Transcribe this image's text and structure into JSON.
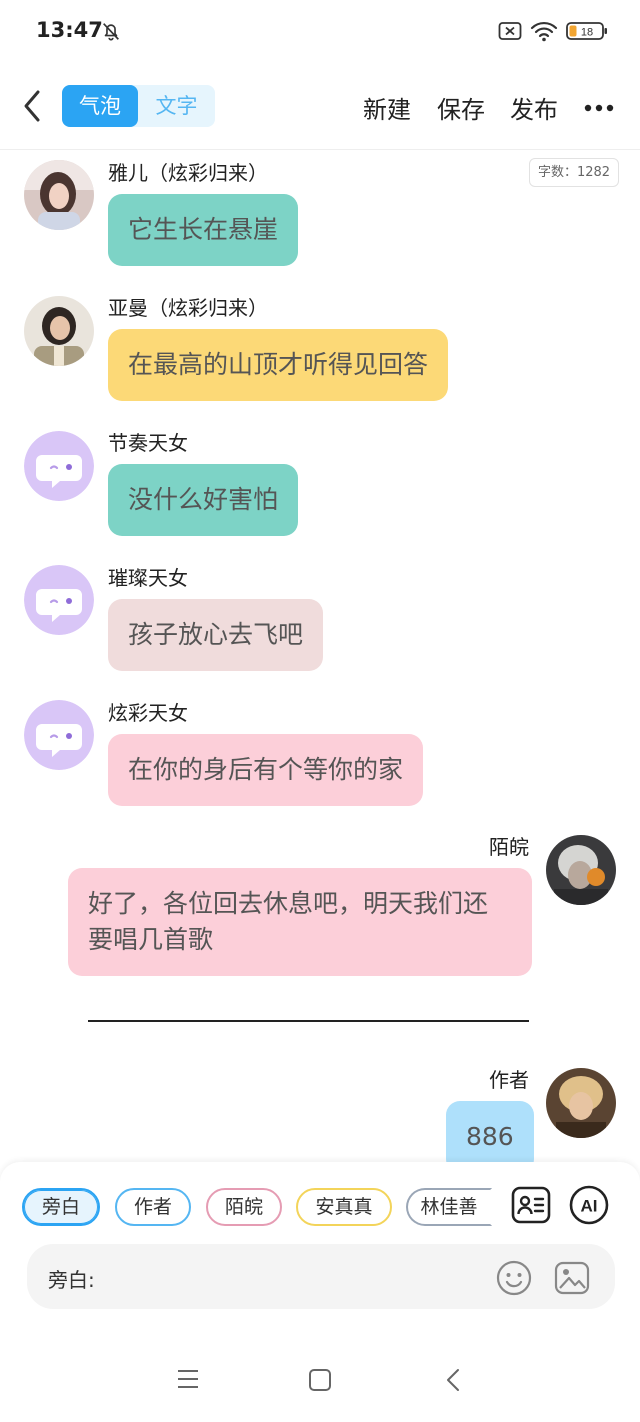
{
  "status_bar": {
    "time": "13:47",
    "battery": "18"
  },
  "header": {
    "mode_bubble": "气泡",
    "mode_text": "文字",
    "new_label": "新建",
    "save_label": "保存",
    "publish_label": "发布"
  },
  "word_count": "字数：1282",
  "messages": [
    {
      "name": "雅儿（炫彩归来）",
      "text": "它生长在悬崖",
      "color": "#7dd3c6"
    },
    {
      "name": "亚曼（炫彩归来）",
      "text": "在最高的山顶才听得见回答",
      "color": "#fcd977"
    },
    {
      "name": "节奏天女",
      "text": "没什么好害怕",
      "color": "#7dd3c6"
    },
    {
      "name": "璀璨天女",
      "text": "孩子放心去飞吧",
      "color": "#f0dcdc"
    },
    {
      "name": "炫彩天女",
      "text": "在你的身后有个等你的家",
      "color": "#fccfd9"
    },
    {
      "name": "陌皖",
      "text": "好了，各位回去休息吧，明天我们还要唱几首歌",
      "color": "#fccfd9"
    },
    {
      "name": "作者",
      "text": "886",
      "color": "#aee0fb"
    }
  ],
  "roles": [
    {
      "label": "旁白",
      "color": "#2ba4f3"
    },
    {
      "label": "作者",
      "color": "#55b6f2"
    },
    {
      "label": "陌皖",
      "color": "#e59cb3"
    },
    {
      "label": "安真真",
      "color": "#f3d45a"
    },
    {
      "label": "林佳善",
      "color": "#9aa6b6"
    }
  ],
  "input": {
    "label": "旁白:"
  },
  "colors": {
    "accent": "#2ba4f3",
    "icon_purple": "#d9c6f7",
    "text_gray": "#555555"
  },
  "icons": [
    "back-arrow-icon",
    "more-icon",
    "role-card-icon",
    "ai-icon",
    "emoji-icon",
    "image-icon",
    "bubble-chat-icon"
  ]
}
